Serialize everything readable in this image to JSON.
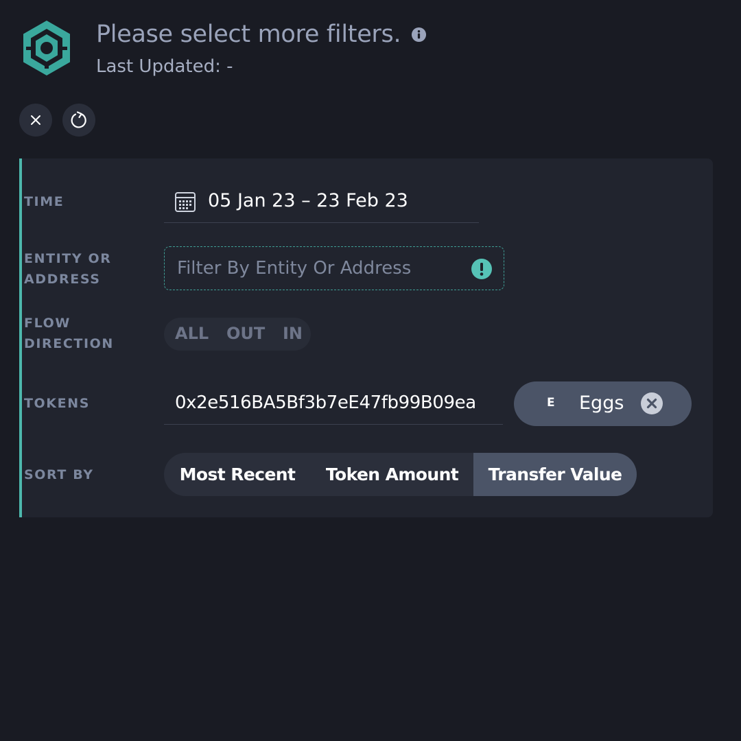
{
  "header": {
    "title": "Please select more filters.",
    "last_updated": "Last Updated: -",
    "info_icon": "info-icon",
    "logo_icon": "hexagon-logo-icon"
  },
  "toolbar": {
    "close_icon": "close-icon",
    "refresh_icon": "refresh-icon"
  },
  "filters": {
    "time": {
      "label": "TIME",
      "value": "05 Jan 23 – 23 Feb 23",
      "icon": "calendar-icon"
    },
    "entity": {
      "label_line1": "ENTITY OR",
      "label_line2": "ADDRESS",
      "placeholder": "Filter By Entity Or Address",
      "value": "",
      "icon": "warning-icon"
    },
    "flow_direction": {
      "label_line1": "FLOW",
      "label_line2": "DIRECTION",
      "options": [
        "ALL",
        "OUT",
        "IN"
      ]
    },
    "tokens": {
      "label": "TOKENS",
      "value": "0x2e516BA5Bf3b7eE47fb99B09ea",
      "chip": {
        "letter": "E",
        "name": "Eggs",
        "remove_icon": "remove-circle-icon"
      }
    },
    "sort_by": {
      "label": "SORT BY",
      "options": [
        "Most Recent",
        "Token Amount",
        "Transfer Value"
      ],
      "selected": "Transfer Value"
    }
  },
  "colors": {
    "background": "#191b23",
    "panel": "#21242e",
    "accent": "#4db8ad",
    "selected": "#4b5467",
    "label": "#7c879e"
  }
}
